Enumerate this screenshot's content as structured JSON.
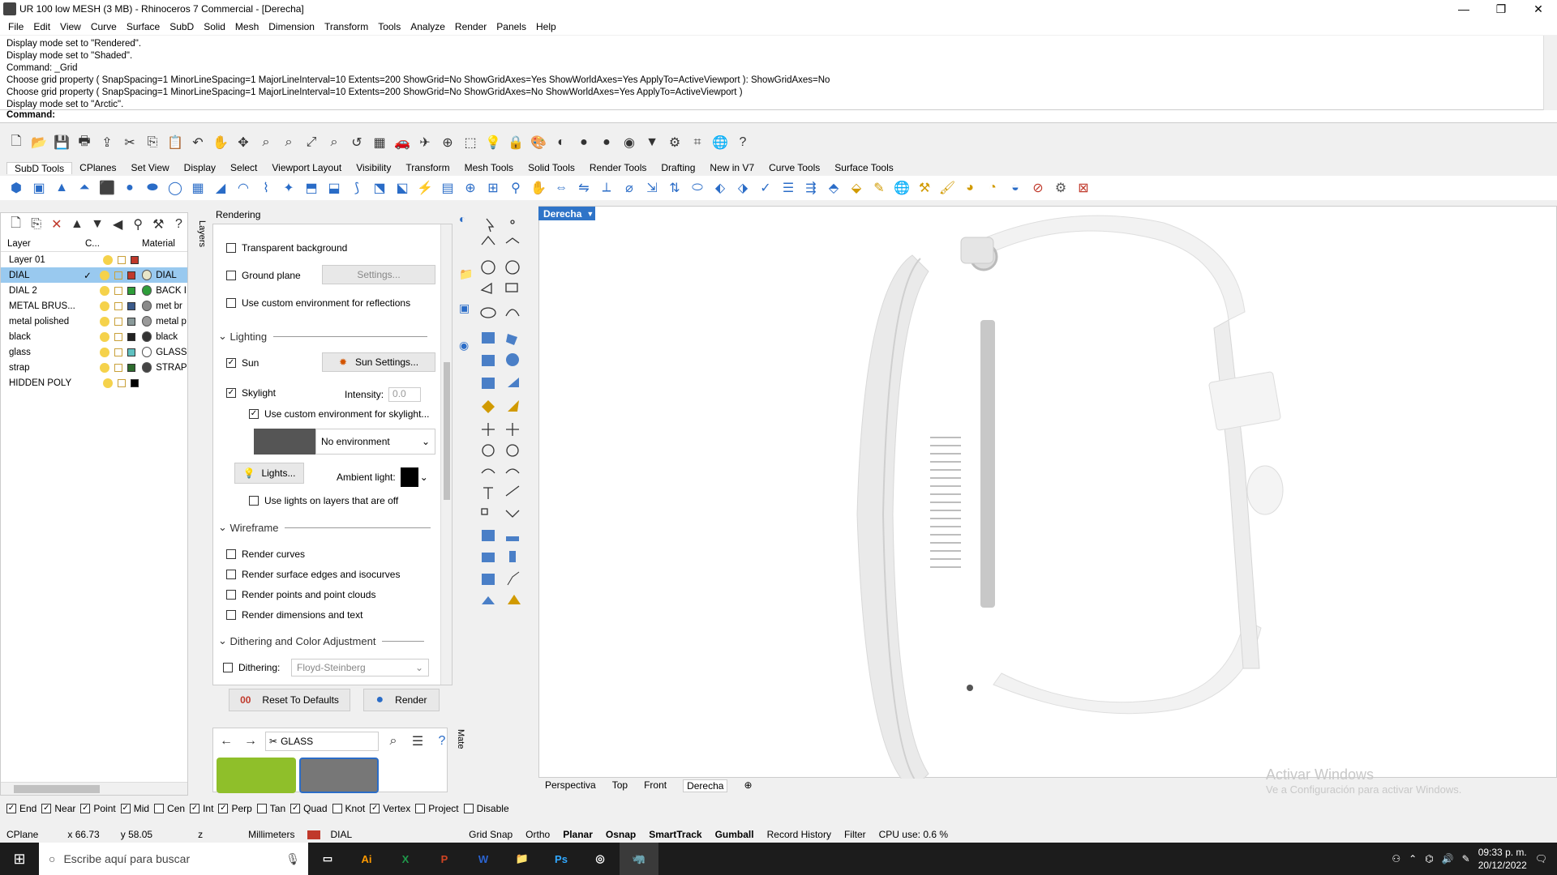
{
  "window": {
    "title": "UR 100 low MESH (3 MB) - Rhinoceros 7 Commercial - [Derecha]",
    "controls": [
      "minimize-icon",
      "maximize-icon",
      "close-icon"
    ]
  },
  "menu": [
    "File",
    "Edit",
    "View",
    "Curve",
    "Surface",
    "SubD",
    "Solid",
    "Mesh",
    "Dimension",
    "Transform",
    "Tools",
    "Analyze",
    "Render",
    "Panels",
    "Help"
  ],
  "command_history": [
    "Display mode set to \"Rendered\".",
    "Display mode set to \"Shaded\".",
    "Command: _Grid",
    "Choose grid property ( SnapSpacing=1  MinorLineSpacing=1  MajorLineInterval=10  Extents=200  ShowGrid=No  ShowGridAxes=Yes  ShowWorldAxes=Yes  ApplyTo=ActiveViewport ): ShowGridAxes=No",
    "Choose grid property ( SnapSpacing=1  MinorLineSpacing=1  MajorLineInterval=10  Extents=200  ShowGrid=No  ShowGridAxes=No  ShowWorldAxes=Yes  ApplyTo=ActiveViewport )",
    "Display mode set to \"Arctic\"."
  ],
  "command_prompt": "Command:",
  "toolbar_tabs": [
    "SubD Tools",
    "CPlanes",
    "Set View",
    "Display",
    "Select",
    "Viewport Layout",
    "Visibility",
    "Transform",
    "Mesh Tools",
    "Solid Tools",
    "Render Tools",
    "Drafting",
    "New in V7",
    "Curve Tools",
    "Surface Tools"
  ],
  "layers": {
    "headers": {
      "name": "Layer",
      "current": "C...",
      "material": "Material"
    },
    "rows": [
      {
        "name": "Layer 01",
        "swatch": "#c0392b",
        "material": "",
        "mat_color": "",
        "current": false,
        "selected": false
      },
      {
        "name": "DIAL",
        "swatch": "#c0392b",
        "material": "DIAL",
        "mat_color": "#e8e6c8",
        "current": true,
        "selected": true
      },
      {
        "name": "DIAL 2",
        "swatch": "#2e9e3a",
        "material": "BACK I",
        "mat_color": "#2e9e3a",
        "current": false,
        "selected": false
      },
      {
        "name": "METAL BRUS...",
        "swatch": "#3b5a8a",
        "material": "met br",
        "mat_color": "#8a8a8a",
        "current": false,
        "selected": false
      },
      {
        "name": "metal polished",
        "swatch": "#8a9a9a",
        "material": "metal p",
        "mat_color": "#9a9a9a",
        "current": false,
        "selected": false
      },
      {
        "name": "black",
        "swatch": "#222222",
        "material": "black",
        "mat_color": "#333333",
        "current": false,
        "selected": false
      },
      {
        "name": "glass",
        "swatch": "#5fc1c1",
        "material": "GLASS",
        "mat_color": "#ffffff",
        "current": false,
        "selected": false
      },
      {
        "name": "strap",
        "swatch": "#2d6b2d",
        "material": "STRAP",
        "mat_color": "#444444",
        "current": false,
        "selected": false
      },
      {
        "name": "HIDDEN POLY",
        "swatch": "#000000",
        "material": "",
        "mat_color": "",
        "current": false,
        "selected": false
      }
    ]
  },
  "layers_side_tab": "Layers",
  "rendering": {
    "panel_title": "Rendering",
    "transparent_background": {
      "label": "Transparent background",
      "checked": false
    },
    "ground_plane": {
      "label": "Ground plane",
      "checked": false,
      "settings_button": "Settings..."
    },
    "custom_env_reflections": {
      "label": "Use custom environment for reflections",
      "checked": false
    },
    "lighting_header": "Lighting",
    "sun": {
      "label": "Sun",
      "checked": true,
      "button": "Sun Settings..."
    },
    "skylight": {
      "label": "Skylight",
      "checked": true,
      "intensity_label": "Intensity:",
      "intensity_value": "0.0"
    },
    "custom_env_skylight": {
      "label": "Use custom environment for skylight...",
      "checked": true
    },
    "environment_select": "No environment",
    "lights_button": "Lights...",
    "ambient_light_label": "Ambient light:",
    "lights_off_layers": {
      "label": "Use lights on layers that are off",
      "checked": false
    },
    "wireframe_header": "Wireframe",
    "render_curves": {
      "label": "Render curves",
      "checked": false
    },
    "render_surface_edges": {
      "label": "Render surface edges and isocurves",
      "checked": false
    },
    "render_points": {
      "label": "Render points and point clouds",
      "checked": false
    },
    "render_dimensions": {
      "label": "Render dimensions and text",
      "checked": false
    },
    "dithering_header": "Dithering and Color Adjustment",
    "dithering": {
      "label": "Dithering:",
      "checked": false,
      "value": "Floyd-Steinberg"
    },
    "reset_button": "Reset To Defaults",
    "render_button": "Render"
  },
  "materials": {
    "search_value": "GLASS",
    "side_tab": "Mate"
  },
  "viewport": {
    "active_label": "Derecha",
    "tabs": [
      "Perspectiva",
      "Top",
      "Front",
      "Derecha"
    ],
    "active_tab": "Derecha"
  },
  "watermark": {
    "line1": "Activar Windows",
    "line2": "Ve a Configuración para activar Windows."
  },
  "osnaps": [
    {
      "label": "End",
      "checked": true
    },
    {
      "label": "Near",
      "checked": true
    },
    {
      "label": "Point",
      "checked": true
    },
    {
      "label": "Mid",
      "checked": true
    },
    {
      "label": "Cen",
      "checked": false
    },
    {
      "label": "Int",
      "checked": true
    },
    {
      "label": "Perp",
      "checked": true
    },
    {
      "label": "Tan",
      "checked": false
    },
    {
      "label": "Quad",
      "checked": true
    },
    {
      "label": "Knot",
      "checked": false
    },
    {
      "label": "Vertex",
      "checked": true
    },
    {
      "label": "Project",
      "checked": false
    },
    {
      "label": "Disable",
      "checked": false
    }
  ],
  "status": {
    "cplane": "CPlane",
    "x": "x 66.73",
    "y": "y 58.05",
    "z": "z",
    "units": "Millimeters",
    "layer": "DIAL",
    "layer_color": "#c0392b",
    "toggles": [
      "Grid Snap",
      "Ortho",
      "Planar",
      "Osnap",
      "SmartTrack",
      "Gumball",
      "Record History",
      "Filter"
    ],
    "bold_toggles": [
      "Planar",
      "Osnap",
      "SmartTrack",
      "Gumball"
    ],
    "cpu": "CPU use: 0.6 %"
  },
  "taskbar": {
    "search_placeholder": "Escribe aquí para buscar",
    "apps": [
      "task-view-icon",
      "illustrator-icon",
      "excel-icon",
      "powerpoint-icon",
      "word-icon",
      "file-explorer-icon",
      "photoshop-icon",
      "obs-icon",
      "rhino-icon"
    ],
    "app_labels": {
      "illustrator": "Ai",
      "photoshop": "Ps",
      "word": "W",
      "excel": "X",
      "powerpoint": "P"
    },
    "time": "09:33 p. m.",
    "date": "20/12/2022"
  }
}
